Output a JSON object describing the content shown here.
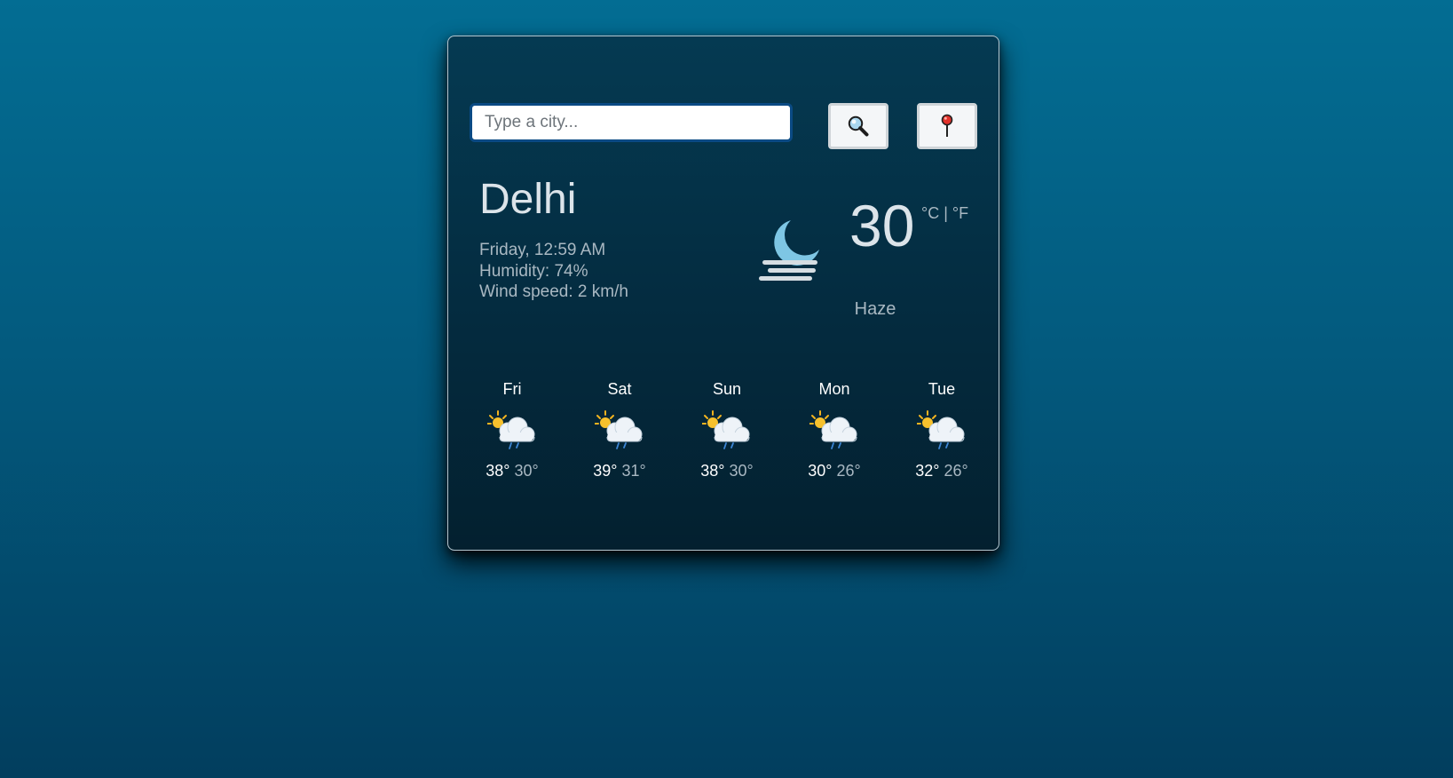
{
  "search": {
    "placeholder": "Type a city...",
    "value": ""
  },
  "buttons": {
    "search_icon": "magnifying-glass",
    "location_icon": "round-pushpin"
  },
  "current": {
    "city": "Delhi",
    "datetime": "Friday, 12:59 AM",
    "humidity": "Humidity: 74%",
    "wind": "Wind speed: 2 km/h",
    "temperature": "30",
    "unit_celsius": "°C",
    "unit_separator": "|",
    "unit_fahrenheit": "°F",
    "condition": "Haze",
    "icon": "moon-haze"
  },
  "forecast": [
    {
      "day": "Fri",
      "max": "38°",
      "min": "30°",
      "icon": "sun-cloud-rain"
    },
    {
      "day": "Sat",
      "max": "39°",
      "min": "31°",
      "icon": "sun-cloud-rain"
    },
    {
      "day": "Sun",
      "max": "38°",
      "min": "30°",
      "icon": "sun-cloud-rain"
    },
    {
      "day": "Mon",
      "max": "30°",
      "min": "26°",
      "icon": "sun-cloud-rain"
    },
    {
      "day": "Tue",
      "max": "32°",
      "min": "26°",
      "icon": "sun-cloud-rain"
    }
  ],
  "colors": {
    "background_top": "#036d93",
    "background_bottom": "#023e5e",
    "card": "#042b3f",
    "primary_text": "#dce4ea",
    "secondary_text": "#a9b8c2",
    "input_border": "#0a4a84"
  }
}
